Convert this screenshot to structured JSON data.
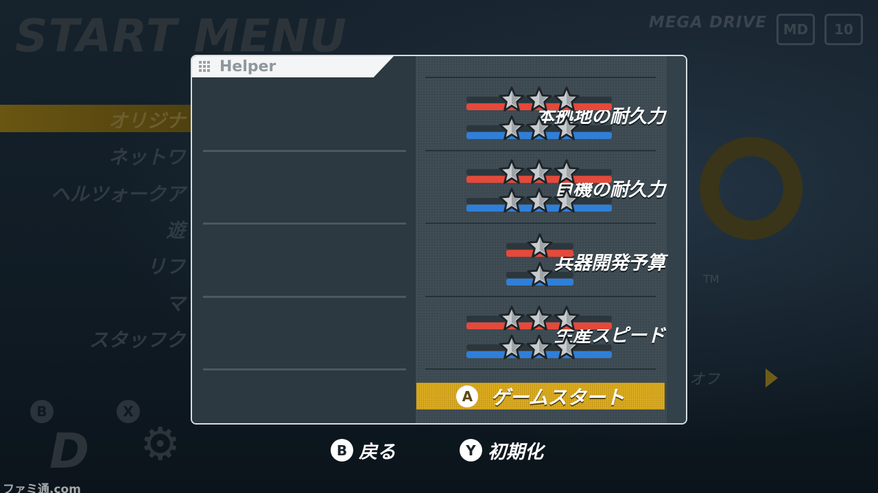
{
  "background": {
    "title": "START MENU",
    "brand": "MEGA DRIVE",
    "logo_a": "MD",
    "logo_b": "10",
    "menu_items": [
      "オリジナ",
      "ネットワ",
      "ヘルツォークア",
      "遊",
      "リフ",
      "マ",
      "スタッフク"
    ],
    "side_text": "オフ",
    "trademark": "TM",
    "button_b": "B",
    "button_x": "X",
    "d_logo": "D",
    "gear_glyph": "⚙"
  },
  "helper": {
    "title": "Helper",
    "rows": [
      {
        "label": "本拠地の耐久力",
        "red_stars": 3,
        "blue_stars": 3
      },
      {
        "label": "自機の耐久力",
        "red_stars": 3,
        "blue_stars": 3
      },
      {
        "label": "兵器開発予算",
        "red_stars": 1,
        "blue_stars": 1
      },
      {
        "label": "生産スピード",
        "red_stars": 3,
        "blue_stars": 3
      }
    ],
    "start_button": {
      "key": "A",
      "label": "ゲームスタート"
    }
  },
  "footer": {
    "back": {
      "key": "B",
      "label": "戻る"
    },
    "reset": {
      "key": "Y",
      "label": "初期化"
    }
  },
  "watermark": "ファミ通.com",
  "colors": {
    "player1_bar": "#e4493a",
    "player2_bar": "#2f7fd9",
    "start_button": "#e0b021",
    "star_fill": "#c9ccce"
  },
  "icons": {
    "helper": "grid-icon",
    "rating": "star-icon"
  }
}
